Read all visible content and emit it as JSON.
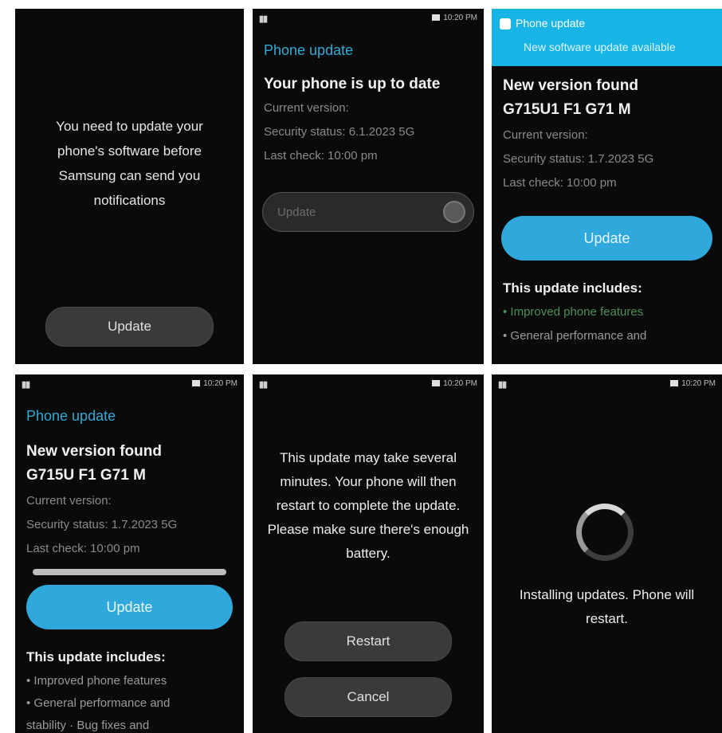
{
  "status": {
    "signal": "▮▮",
    "right_text": "10:20 PM"
  },
  "screen1": {
    "message": "You need to update your phone's software before Samsung can send you notifications",
    "button": "Update"
  },
  "screen2": {
    "title": "Phone update",
    "heading": "Your phone is up to date",
    "lines": [
      "Current version:",
      "Security status: 6.1.2023 5G",
      "Last check: 10:00 pm"
    ],
    "field_placeholder": "Update"
  },
  "screen3": {
    "notification": {
      "line1": "Phone update",
      "line2": "New software update available"
    },
    "heading_lines": [
      "New version found",
      "G715U1 F1 G71 M"
    ],
    "lines": [
      "Current version:",
      "Security status: 1.7.2023 5G",
      "Last check: 10:00 pm"
    ],
    "button": "Update",
    "includes_title": "This update includes:",
    "bullets": [
      "• Improved phone features",
      "• General performance and"
    ]
  },
  "screen4": {
    "title": "Phone update",
    "heading_lines": [
      "New version found",
      "G715U F1 G71 M"
    ],
    "lines": [
      "Current version:",
      "Security status: 1.7.2023 5G",
      "Last check: 10:00 pm"
    ],
    "button": "Update",
    "includes_title": "This update includes:",
    "bullets": [
      "• Improved phone features",
      "• General performance and",
      "stability   · Bug fixes and"
    ]
  },
  "screen5": {
    "message": "This update may take several minutes. Your phone will then restart to complete the update. Please make sure there's enough battery.",
    "restart": "Restart",
    "cancel": "Cancel"
  },
  "screen6": {
    "message": "Installing updates. Phone will restart."
  }
}
